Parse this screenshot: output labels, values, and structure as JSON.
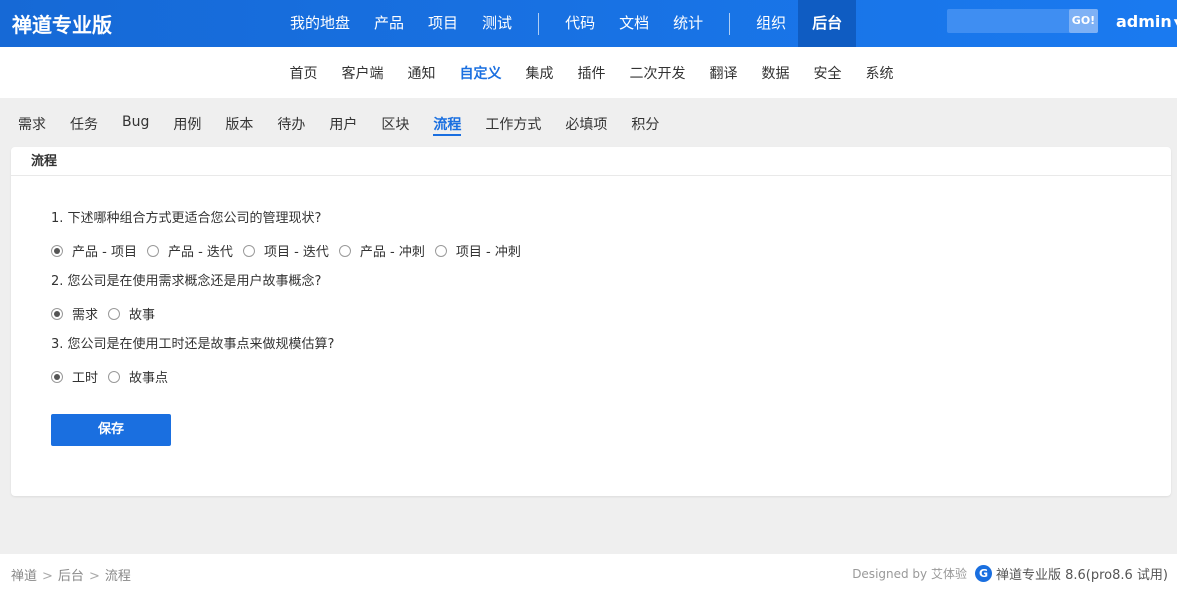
{
  "header": {
    "brand": "禅道专业版",
    "nav_group1": [
      "我的地盘",
      "产品",
      "项目",
      "测试"
    ],
    "nav_group2": [
      "代码",
      "文档",
      "统计"
    ],
    "nav_group3": [
      "组织",
      "后台"
    ],
    "search_button": "GO!",
    "user": "admin",
    "colors": {
      "accent": "#1a6fe0",
      "active_bg": "#0f5cc2"
    }
  },
  "subnav": {
    "items": [
      "首页",
      "客户端",
      "通知",
      "自定义",
      "集成",
      "插件",
      "二次开发",
      "翻译",
      "数据",
      "安全",
      "系统"
    ],
    "active": "自定义"
  },
  "tabs": {
    "items": [
      "需求",
      "任务",
      "Bug",
      "用例",
      "版本",
      "待办",
      "用户",
      "区块",
      "流程",
      "工作方式",
      "必填项",
      "积分"
    ],
    "active": "流程"
  },
  "panel": {
    "title": "流程",
    "questions": [
      {
        "text": "1. 下述哪种组合方式更适合您公司的管理现状?",
        "options": [
          "产品 - 项目",
          "产品 - 迭代",
          "项目 - 迭代",
          "产品 - 冲刺",
          "项目 - 冲刺"
        ],
        "selected": 0
      },
      {
        "text": "2. 您公司是在使用需求概念还是用户故事概念?",
        "options": [
          "需求",
          "故事"
        ],
        "selected": 0
      },
      {
        "text": "3. 您公司是在使用工时还是故事点来做规模估算?",
        "options": [
          "工时",
          "故事点"
        ],
        "selected": 0
      }
    ],
    "save_label": "保存"
  },
  "footer": {
    "breadcrumb": [
      "禅道",
      "后台",
      "流程"
    ],
    "breadcrumb_sep": ">",
    "designed_by": "Designed by 艾体验",
    "version": "禅道专业版 8.6(pro8.6 试用)"
  }
}
